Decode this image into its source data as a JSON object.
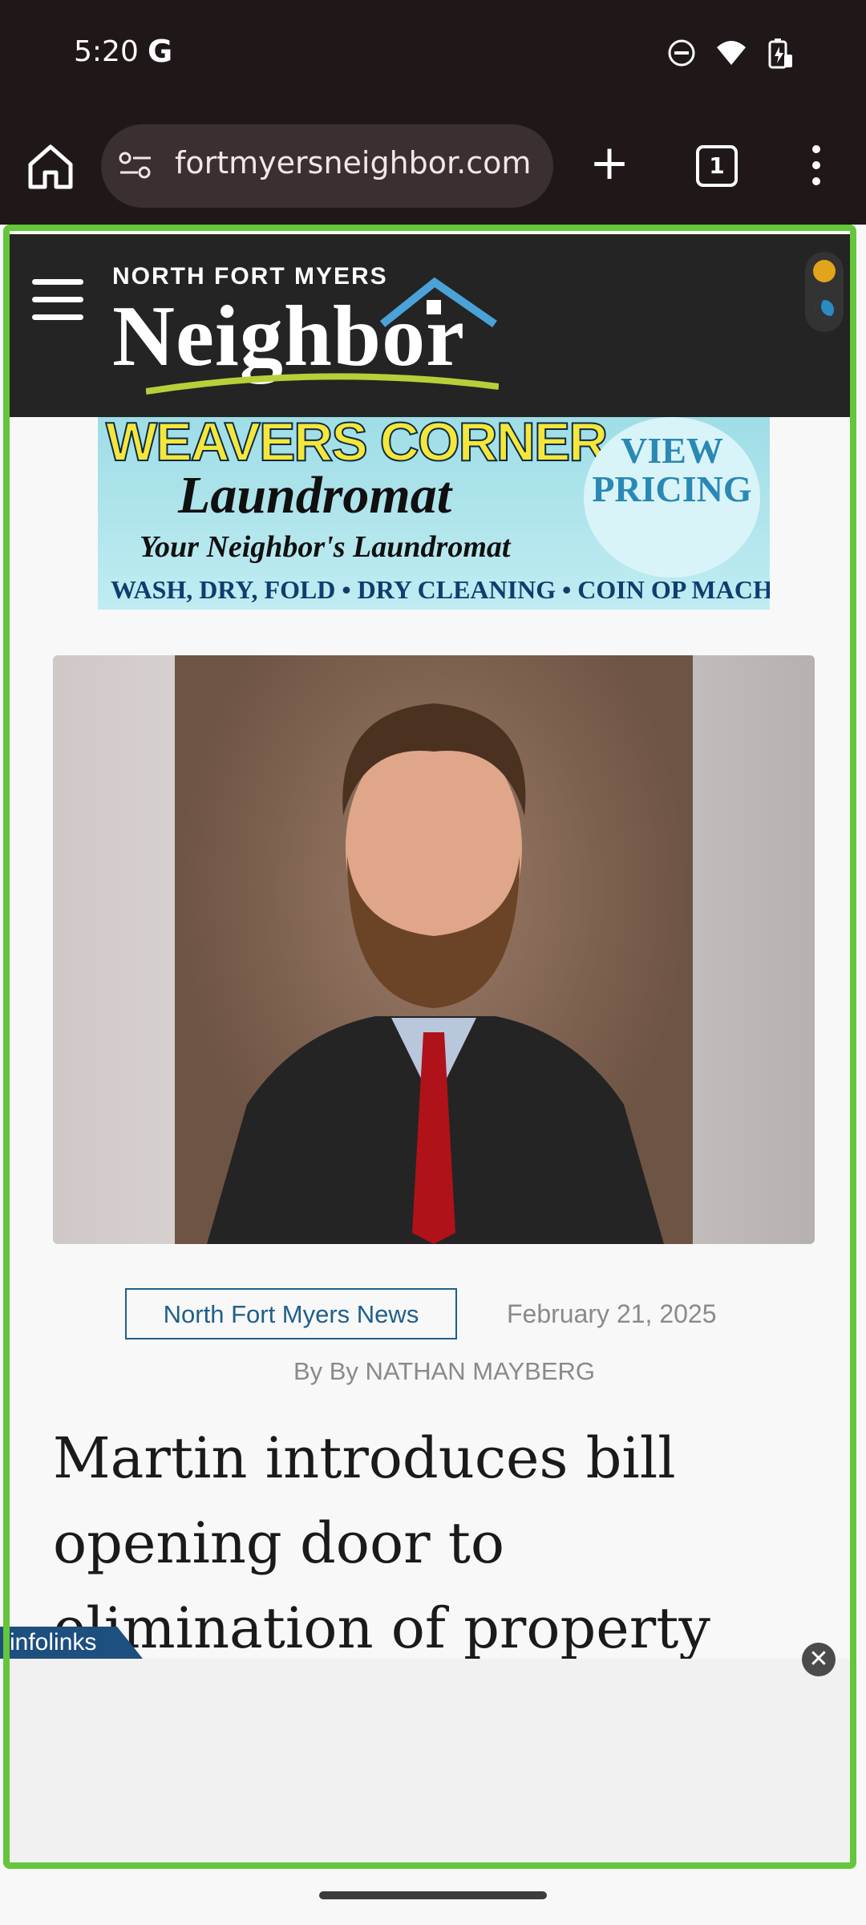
{
  "status_bar": {
    "time": "5:20",
    "google_glyph": "G",
    "icons": [
      "do-not-disturb-icon",
      "wifi-icon",
      "battery-charging-icon"
    ]
  },
  "browser": {
    "url": "fortmyersneighbor.com",
    "new_tab_label": "+",
    "tab_count": "1"
  },
  "site": {
    "logo_small": "NORTH FORT MYERS",
    "logo_big": "Neighbor"
  },
  "ad_banner": {
    "title": "WEAVERS CORNER",
    "subtitle": "Laundromat",
    "tagline": "Your Neighbor's Laundromat",
    "services": "WASH, DRY, FOLD • DRY CLEANING • COIN OP MACHINES",
    "cta": "VIEW PRICING"
  },
  "article": {
    "category": "North Fort Myers News",
    "date": "February 21, 2025",
    "byline": "By By NATHAN MAYBERG",
    "headline": "Martin introduces bill opening door to elimination of property taxes though"
  },
  "bottom_ad": {
    "brand": "infolinks",
    "close_label": "✕"
  },
  "colors": {
    "frame": "#63c63b",
    "header_bg": "#242424",
    "category": "#1f5f8a"
  }
}
